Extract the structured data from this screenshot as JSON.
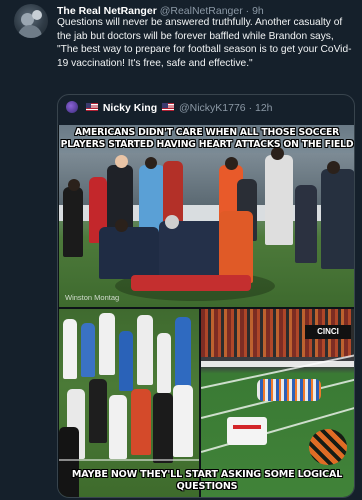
{
  "tweet": {
    "author_name": "The Real NetRanger",
    "author_handle": "@RealNetRanger",
    "separator": "·",
    "time": "9h",
    "text": "Questions will never be answered truthfully. Another casualty of the jab but doctors will be forever baffled while Brandon says, \"The best way to prepare for football season is to get your CoVid-19 vaccination! It's free, safe and effective.\""
  },
  "quote": {
    "author_name": "Nicky King",
    "author_handle": "@NickyK1776",
    "separator": "·",
    "time": "12h",
    "meme_top_text": "Americans didn't care when all those soccer players started having heart attacks on the field",
    "meme_bottom_text": "Maybe now they'll start asking some logical questions",
    "watermark": "Winston Montag",
    "banner_text": "CINCI"
  },
  "icons": {
    "avatar": "profile-avatar",
    "quote_avatar": "profile-avatar-small",
    "flag": "us-flag-emoji"
  },
  "colors": {
    "background": "#15202b",
    "secondary_text": "#8b98a5",
    "border": "#38444d"
  }
}
